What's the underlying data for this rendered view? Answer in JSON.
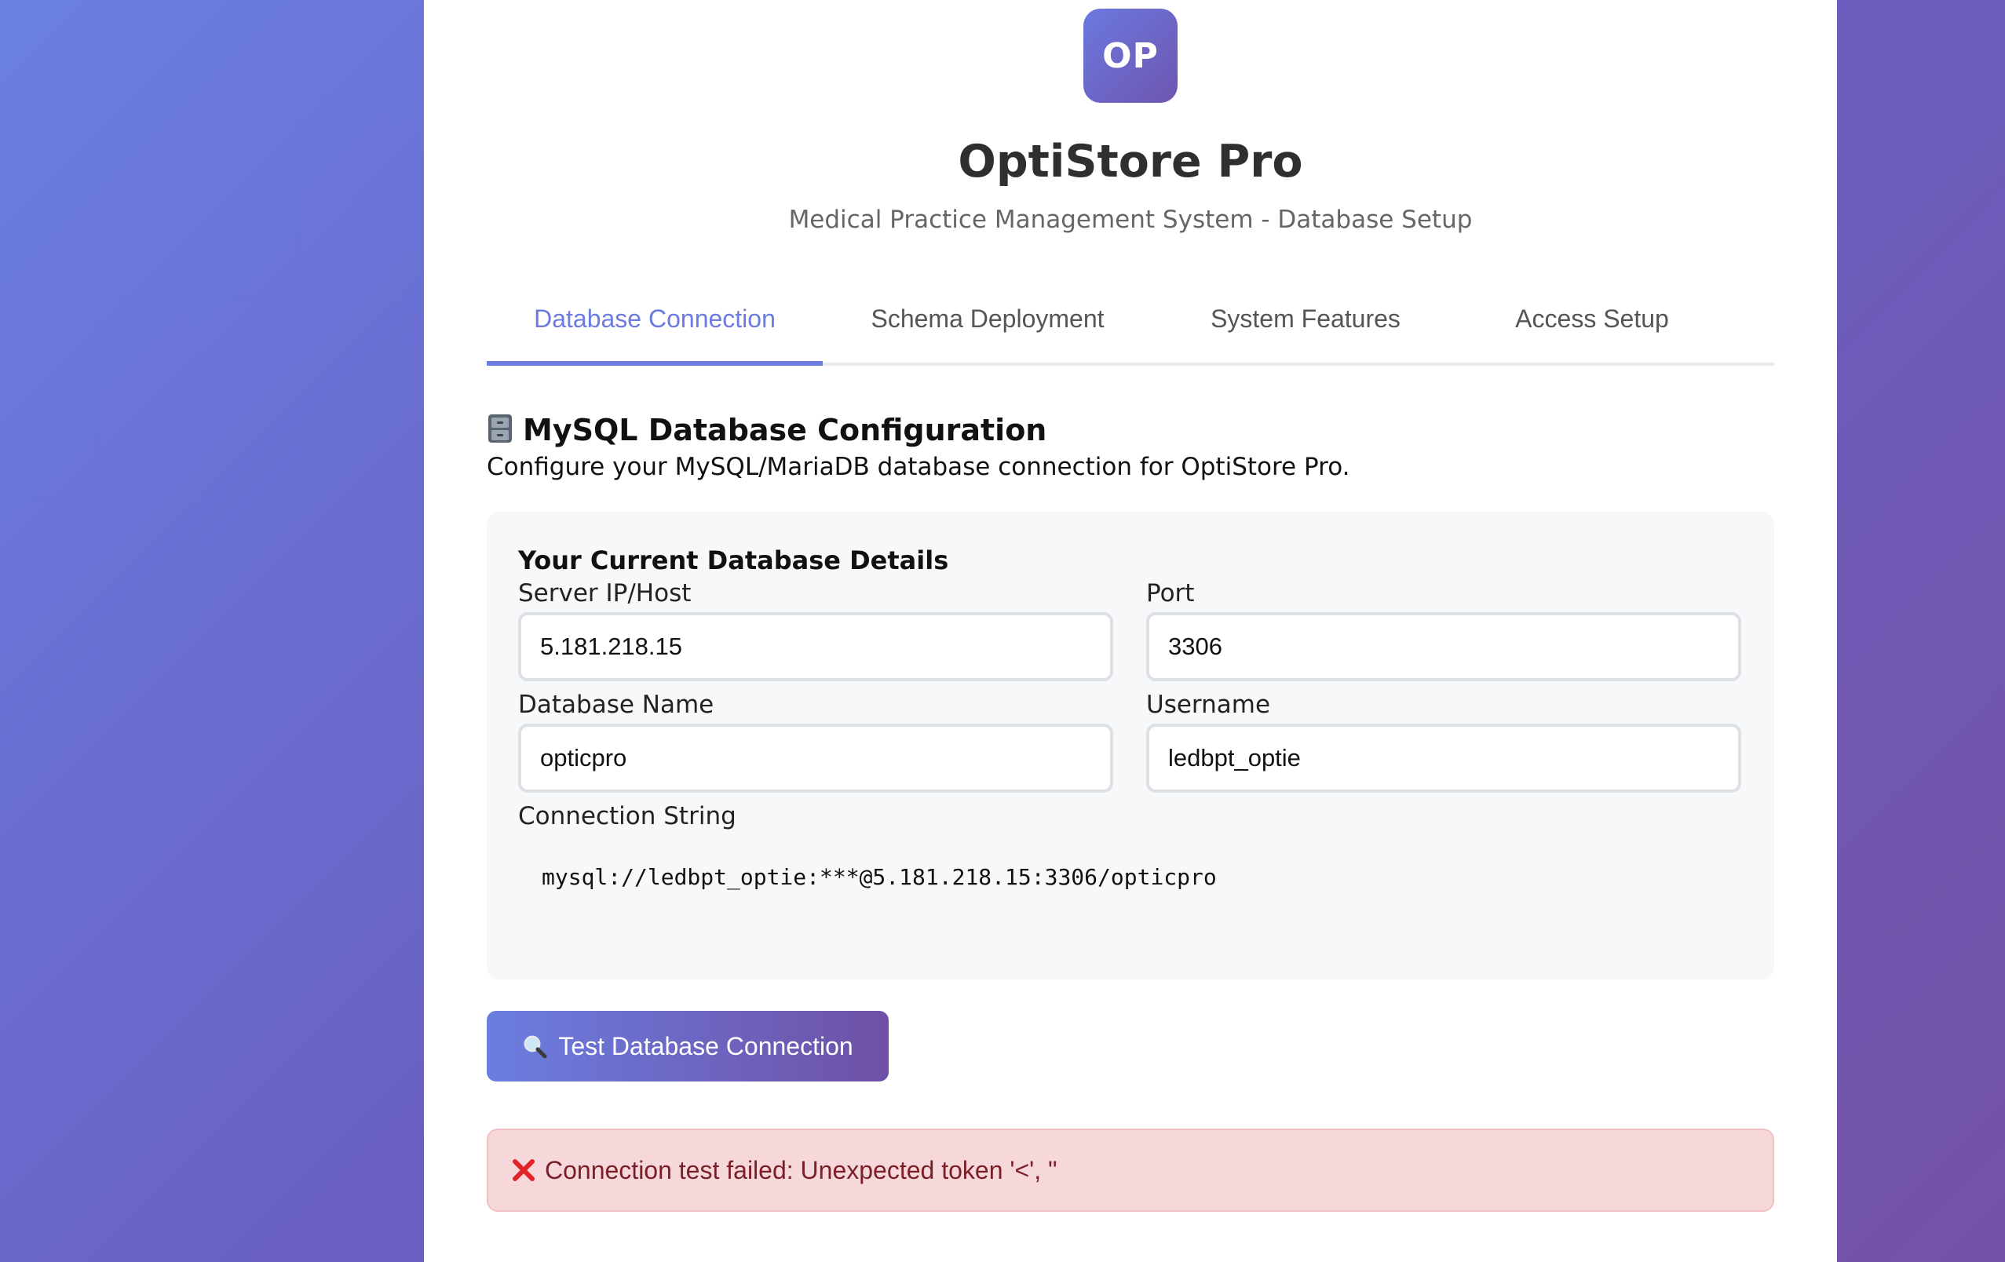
{
  "app": {
    "logo_text": "OP",
    "title": "OptiStore Pro",
    "subtitle": "Medical Practice Management System - Database Setup"
  },
  "tabs": [
    {
      "label": "Database Connection",
      "active": true
    },
    {
      "label": "Schema Deployment",
      "active": false
    },
    {
      "label": "System Features",
      "active": false
    },
    {
      "label": "Access Setup",
      "active": false
    }
  ],
  "section": {
    "icon": "file-cabinet-icon",
    "title": "MySQL Database Configuration",
    "description": "Configure your MySQL/MariaDB database connection for OptiStore Pro."
  },
  "panel": {
    "title": "Your Current Database Details",
    "fields": {
      "host": {
        "label": "Server IP/Host",
        "value": "5.181.218.15"
      },
      "port": {
        "label": "Port",
        "value": "3306"
      },
      "database": {
        "label": "Database Name",
        "value": "opticpro"
      },
      "username": {
        "label": "Username",
        "value": "ledbpt_optie"
      }
    },
    "connection_string": {
      "label": "Connection String",
      "value": "mysql://ledbpt_optie:***@5.181.218.15:3306/opticpro"
    }
  },
  "actions": {
    "test_button": {
      "icon": "magnifier-icon",
      "label": "Test Database Connection"
    }
  },
  "status": {
    "type": "error",
    "icon": "cross-mark-icon",
    "message": "Connection test failed: Unexpected token '<', \""
  },
  "colors": {
    "accent": "#6b7bde",
    "error_bg": "#f6d7da",
    "error_text": "#7a1f28"
  }
}
